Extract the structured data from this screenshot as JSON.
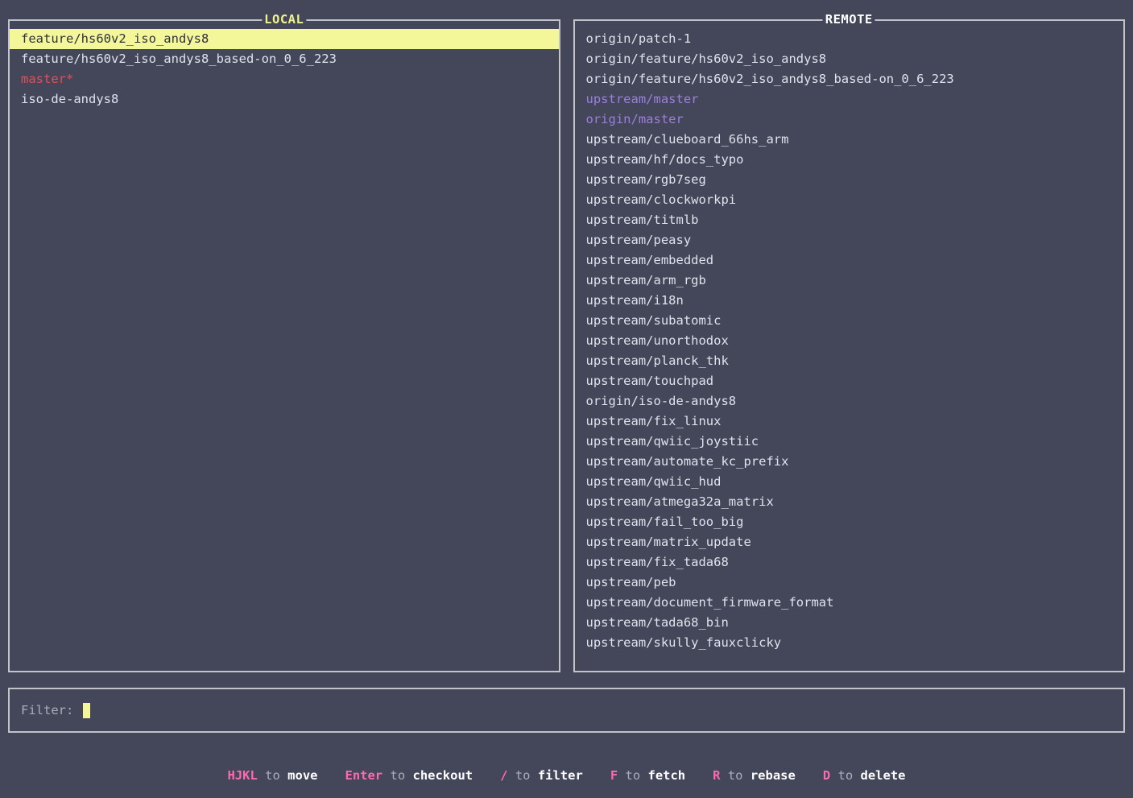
{
  "panels": {
    "local": {
      "title": "LOCAL",
      "active": true,
      "branches": [
        {
          "name": "feature/hs60v2_iso_andys8",
          "style": "selected"
        },
        {
          "name": "feature/hs60v2_iso_andys8_based-on_0_6_223",
          "style": "normal"
        },
        {
          "name": "master*",
          "style": "red"
        },
        {
          "name": "iso-de-andys8",
          "style": "normal"
        }
      ]
    },
    "remote": {
      "title": "REMOTE",
      "active": false,
      "branches": [
        {
          "name": "origin/patch-1",
          "style": "normal"
        },
        {
          "name": "origin/feature/hs60v2_iso_andys8",
          "style": "normal"
        },
        {
          "name": "origin/feature/hs60v2_iso_andys8_based-on_0_6_223",
          "style": "normal"
        },
        {
          "name": "upstream/master",
          "style": "purple"
        },
        {
          "name": "origin/master",
          "style": "purple"
        },
        {
          "name": "upstream/clueboard_66hs_arm",
          "style": "normal"
        },
        {
          "name": "upstream/hf/docs_typo",
          "style": "normal"
        },
        {
          "name": "upstream/rgb7seg",
          "style": "normal"
        },
        {
          "name": "upstream/clockworkpi",
          "style": "normal"
        },
        {
          "name": "upstream/titmlb",
          "style": "normal"
        },
        {
          "name": "upstream/peasy",
          "style": "normal"
        },
        {
          "name": "upstream/embedded",
          "style": "normal"
        },
        {
          "name": "upstream/arm_rgb",
          "style": "normal"
        },
        {
          "name": "upstream/i18n",
          "style": "normal"
        },
        {
          "name": "upstream/subatomic",
          "style": "normal"
        },
        {
          "name": "upstream/unorthodox",
          "style": "normal"
        },
        {
          "name": "upstream/planck_thk",
          "style": "normal"
        },
        {
          "name": "upstream/touchpad",
          "style": "normal"
        },
        {
          "name": "origin/iso-de-andys8",
          "style": "normal"
        },
        {
          "name": "upstream/fix_linux",
          "style": "normal"
        },
        {
          "name": "upstream/qwiic_joystiic",
          "style": "normal"
        },
        {
          "name": "upstream/automate_kc_prefix",
          "style": "normal"
        },
        {
          "name": "upstream/qwiic_hud",
          "style": "normal"
        },
        {
          "name": "upstream/atmega32a_matrix",
          "style": "normal"
        },
        {
          "name": "upstream/fail_too_big",
          "style": "normal"
        },
        {
          "name": "upstream/matrix_update",
          "style": "normal"
        },
        {
          "name": "upstream/fix_tada68",
          "style": "normal"
        },
        {
          "name": "upstream/peb",
          "style": "normal"
        },
        {
          "name": "upstream/document_firmware_format",
          "style": "normal"
        },
        {
          "name": "upstream/tada68_bin",
          "style": "normal"
        },
        {
          "name": "upstream/skully_fauxclicky",
          "style": "normal"
        }
      ]
    }
  },
  "filter": {
    "label": "Filter: ",
    "value": "",
    "placeholder": ""
  },
  "help": {
    "hints": [
      {
        "key": "HJKL",
        "to": " to ",
        "action": "move"
      },
      {
        "key": "Enter",
        "to": " to ",
        "action": "checkout"
      },
      {
        "key": "/",
        "to": " to ",
        "action": "filter"
      },
      {
        "key": "F",
        "to": " to ",
        "action": "fetch"
      },
      {
        "key": "R",
        "to": " to ",
        "action": "rebase"
      },
      {
        "key": "D",
        "to": " to ",
        "action": "delete"
      }
    ]
  },
  "colors": {
    "background": "#434759",
    "border": "#c3c4ca",
    "text": "#dfe3ec",
    "selected_bg": "#f3f79a",
    "selected_fg": "#30313c",
    "red": "#e0505a",
    "purple": "#9b7fe0",
    "yellow": "#eff28a",
    "pink": "#fd6ab0"
  }
}
